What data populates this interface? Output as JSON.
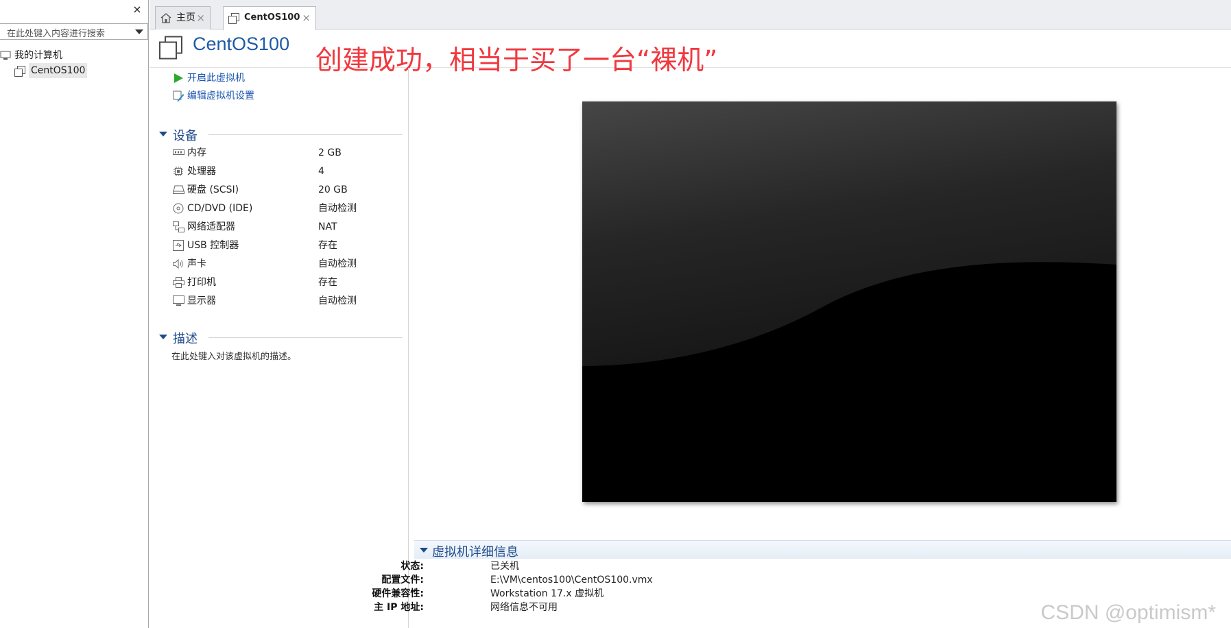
{
  "library": {
    "close_label": "×",
    "search_placeholder": "在此处键入内容进行搜索",
    "tree": [
      {
        "label": "我的计算机"
      },
      {
        "label": "CentOS100"
      }
    ]
  },
  "tabs": [
    {
      "label": "主页",
      "close": "×"
    },
    {
      "label": "CentOS100",
      "close": "×"
    }
  ],
  "vm": {
    "title": "CentOS100",
    "annotation": "创建成功，相当于买了一台“裸机”",
    "actions": [
      {
        "label": "开启此虚拟机"
      },
      {
        "label": "编辑虚拟机设置"
      }
    ],
    "devices_header": "设备",
    "devices": [
      {
        "name": "内存",
        "value": "2 GB",
        "icon": "memory-icon"
      },
      {
        "name": "处理器",
        "value": "4",
        "icon": "processor-icon"
      },
      {
        "name": "硬盘 (SCSI)",
        "value": "20 GB",
        "icon": "hard-disk-icon"
      },
      {
        "name": "CD/DVD (IDE)",
        "value": "自动检测",
        "icon": "cd-dvd-icon"
      },
      {
        "name": "网络适配器",
        "value": "NAT",
        "icon": "network-adapter-icon"
      },
      {
        "name": "USB 控制器",
        "value": "存在",
        "icon": "usb-icon"
      },
      {
        "name": "声卡",
        "value": "自动检测",
        "icon": "sound-icon"
      },
      {
        "name": "打印机",
        "value": "存在",
        "icon": "printer-icon"
      },
      {
        "name": "显示器",
        "value": "自动检测",
        "icon": "display-icon"
      }
    ],
    "description_header": "描述",
    "description_placeholder": "在此处键入对该虚拟机的描述。",
    "details_header": "虚拟机详细信息",
    "details": [
      {
        "key": "状态:",
        "value": "已关机"
      },
      {
        "key": "配置文件:",
        "value": "E:\\VM\\centos100\\CentOS100.vmx"
      },
      {
        "key": "硬件兼容性:",
        "value": "Workstation 17.x 虚拟机"
      },
      {
        "key": "主 IP 地址:",
        "value": "网络信息不可用"
      }
    ]
  },
  "watermark": "CSDN @optimism*",
  "colors": {
    "accent": "#1e5aa8",
    "annotation": "#f0383f",
    "play": "#2ea82e"
  }
}
